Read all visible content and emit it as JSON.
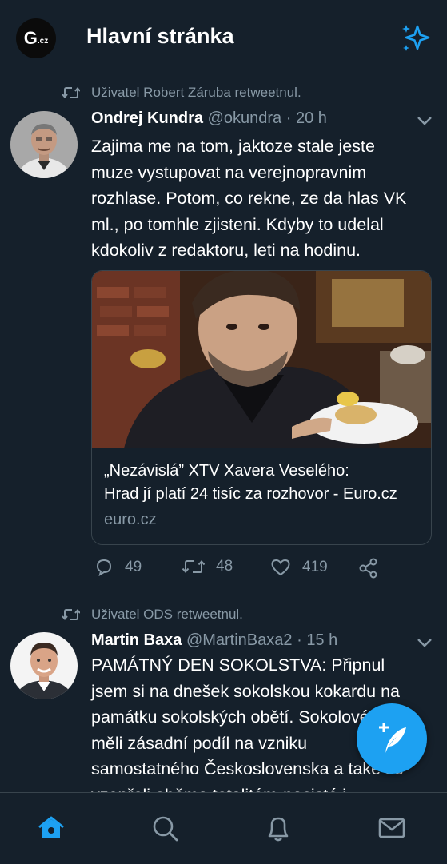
{
  "header": {
    "logo_text": "G",
    "logo_suffix": ".cz",
    "title": "Hlavní stránka",
    "sparkle_icon": "sparkle-icon"
  },
  "tweets": [
    {
      "retweet_text": "Uživatel Robert Záruba retweetnul.",
      "author_name": "Ondrej Kundra",
      "handle": "@okundra",
      "separator": "·",
      "time": "20 h",
      "lines": [
        "Zajima me na tom, jaktoze stale jeste",
        "muze vystupovat na verejnopravnim",
        "rozhlase. Potom, co rekne, ze da hlas VK",
        "ml., po tomhle zjisteni. Kdyby to udelal",
        "kdokoliv z redaktoru, leti na hodinu."
      ],
      "card": {
        "title_line1": "„Nezávislá” XTV Xavera Veselého:",
        "title_line2": "Hrad jí platí 24 tisíc za rozhovor - Euro.cz",
        "domain": "euro.cz"
      },
      "replies": "49",
      "retweets": "48",
      "likes": "419"
    },
    {
      "retweet_text": "Uživatel ODS retweetnul.",
      "author_name": "Martin Baxa",
      "handle": "@MartinBaxa2",
      "separator": "·",
      "time": "15 h",
      "lines": [
        "PAMÁTNÝ DEN SOKOLSTVA: Připnul",
        "jsem si na dnešek sokolskou kokardu na",
        "památku sokolských obětí. Sokolové",
        "měli zásadní podíl na vzniku",
        "samostatného Československa a také se",
        "vzepřeli oběma totalitám-nacisté i"
      ]
    }
  ],
  "nav": {
    "items": [
      "home-icon",
      "search-icon",
      "notifications-icon",
      "messages-icon"
    ]
  },
  "colors": {
    "background": "#15202b",
    "accent": "#1da1f2",
    "secondary_text": "#8899a6",
    "border": "#38444d"
  }
}
